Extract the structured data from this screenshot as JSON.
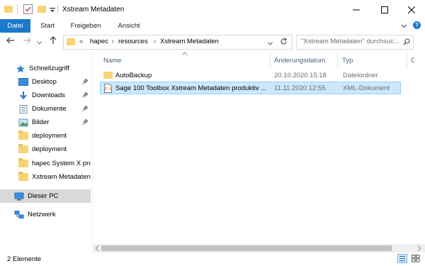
{
  "window": {
    "title": "Xstream Metadaten"
  },
  "ribbon": {
    "tabs": [
      "Datei",
      "Start",
      "Freigeben",
      "Ansicht"
    ]
  },
  "address": {
    "breadcrumb_prefix": "«",
    "crumbs": [
      "hapec",
      "resources",
      "Xstream Metadaten"
    ],
    "search_placeholder": "\"Xstream Metadaten\" durchsuc..."
  },
  "sidebar": {
    "items": [
      {
        "label": "Schnellzugriff",
        "icon": "star-icon",
        "pinned": false
      },
      {
        "label": "Desktop",
        "icon": "desktop-icon",
        "pinned": true
      },
      {
        "label": "Downloads",
        "icon": "download-arrow-icon",
        "pinned": true
      },
      {
        "label": "Dokumente",
        "icon": "documents-icon",
        "pinned": true
      },
      {
        "label": "Bilder",
        "icon": "pictures-icon",
        "pinned": true
      },
      {
        "label": "deployment",
        "icon": "folder-icon",
        "pinned": false
      },
      {
        "label": "deployment",
        "icon": "folder-icon",
        "pinned": false
      },
      {
        "label": "hapec System X pro",
        "icon": "folder-icon",
        "pinned": false
      },
      {
        "label": "Xstream Metadaten",
        "icon": "folder-icon",
        "pinned": false
      },
      {
        "label": "Dieser PC",
        "icon": "computer-icon",
        "pinned": false,
        "selected": true
      },
      {
        "label": "Netzwerk",
        "icon": "network-icon",
        "pinned": false
      }
    ]
  },
  "columns": {
    "name": "Name",
    "date": "Änderungsdatum",
    "type": "Typ",
    "size": "Größ"
  },
  "files": [
    {
      "name": "AutoBackup",
      "date": "20.10.2020 15:18",
      "type": "Dateiordner",
      "icon": "folder-icon"
    },
    {
      "name": "Sage 100 Toolbox Xstream Metadaten produktiv ...",
      "date": "11.11.2020 12:55",
      "type": "XML-Dokument",
      "icon": "xml-file-icon",
      "selected": true
    }
  ],
  "status": {
    "count": "2 Elemente"
  },
  "colors": {
    "accent": "#1979ca",
    "selection": "#cce8ff",
    "nav_selected": "#d9d9d9"
  }
}
